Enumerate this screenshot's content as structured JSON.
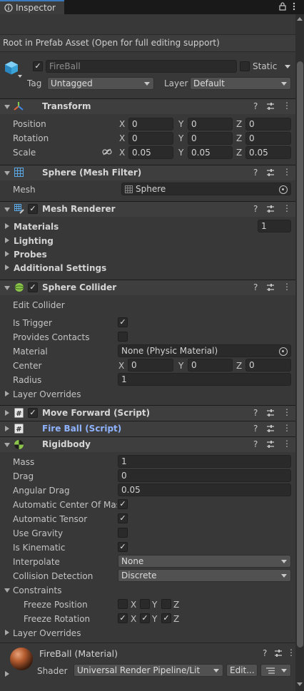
{
  "tab": {
    "label": "Inspector"
  },
  "prefab": {
    "notice": "Root in Prefab Asset (Open for full editing support)"
  },
  "gameobject": {
    "name": "FireBall",
    "static_label": "Static",
    "tag_label": "Tag",
    "tag_value": "Untagged",
    "layer_label": "Layer",
    "layer_value": "Default"
  },
  "transform": {
    "title": "Transform",
    "rows": [
      {
        "label": "Position",
        "x": "0",
        "y": "0",
        "z": "0"
      },
      {
        "label": "Rotation",
        "x": "0",
        "y": "0",
        "z": "0"
      },
      {
        "label": "Scale",
        "x": "0.05",
        "y": "0.05",
        "z": "0.05"
      }
    ]
  },
  "axes": {
    "x": "X",
    "y": "Y",
    "z": "Z"
  },
  "mesh_filter": {
    "title": "Sphere (Mesh Filter)",
    "mesh_label": "Mesh",
    "mesh_value": "Sphere"
  },
  "mesh_renderer": {
    "title": "Mesh Renderer",
    "materials_label": "Materials",
    "materials_count": "1",
    "lighting_label": "Lighting",
    "probes_label": "Probes",
    "additional_label": "Additional Settings"
  },
  "sphere_collider": {
    "title": "Sphere Collider",
    "edit_collider": "Edit Collider",
    "is_trigger_label": "Is Trigger",
    "is_trigger": true,
    "provides_contacts_label": "Provides Contacts",
    "provides_contacts": false,
    "material_label": "Material",
    "material_value": "None (Physic Material)",
    "center_label": "Center",
    "center": {
      "x": "0",
      "y": "0",
      "z": "0"
    },
    "radius_label": "Radius",
    "radius": "1",
    "layer_overrides": "Layer Overrides"
  },
  "move_forward": {
    "title": "Move Forward (Script)"
  },
  "fire_ball_script": {
    "title": "Fire Ball (Script)"
  },
  "rigidbody": {
    "title": "Rigidbody",
    "mass_label": "Mass",
    "mass": "1",
    "drag_label": "Drag",
    "drag": "0",
    "angular_drag_label": "Angular Drag",
    "angular_drag": "0.05",
    "auto_com_label": "Automatic Center Of Mass",
    "auto_com": true,
    "auto_tensor_label": "Automatic Tensor",
    "auto_tensor": true,
    "use_gravity_label": "Use Gravity",
    "use_gravity": false,
    "is_kinematic_label": "Is Kinematic",
    "is_kinematic": true,
    "interpolate_label": "Interpolate",
    "interpolate": "None",
    "collision_label": "Collision Detection",
    "collision": "Discrete",
    "constraints_label": "Constraints",
    "freeze_position_label": "Freeze Position",
    "freeze_rotation_label": "Freeze Rotation",
    "freeze_position": {
      "x": false,
      "y": false,
      "z": false
    },
    "freeze_rotation": {
      "x": true,
      "y": true,
      "z": true
    },
    "layer_overrides": "Layer Overrides"
  },
  "material": {
    "title": "FireBall (Material)",
    "shader_label": "Shader",
    "shader_value": "Universal Render Pipeline/Lit",
    "edit_label": "Edit..."
  },
  "glyphs": {
    "check": "✓",
    "help": "?",
    "more": "⋮",
    "lock": "🔒"
  },
  "colors": {
    "accent": "#3a79bb",
    "background": "#383838",
    "link": "#8fb3ff"
  }
}
